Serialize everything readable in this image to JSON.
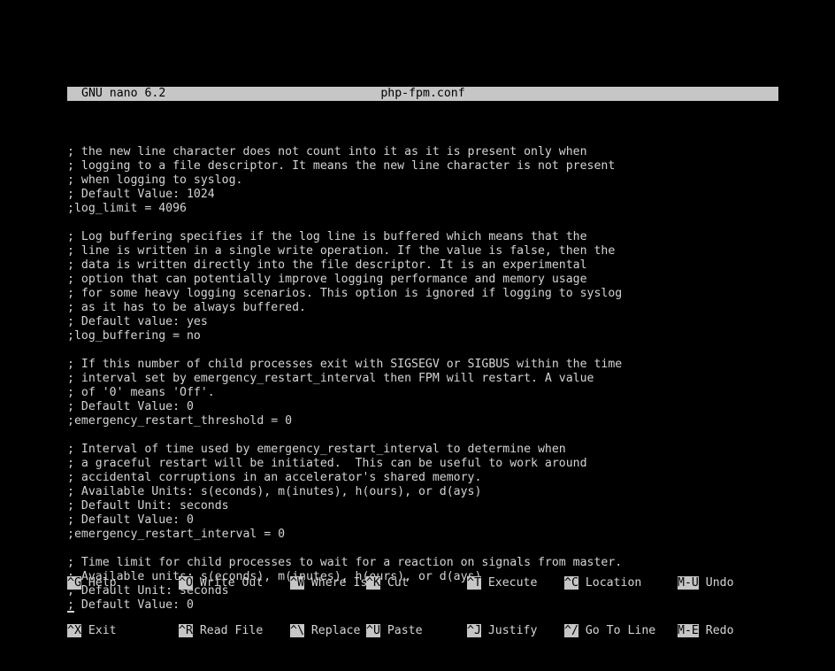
{
  "app": {
    "name": "GNU nano",
    "version_label": "GNU nano 6.2",
    "filename": "php-fpm.conf"
  },
  "editor": {
    "lines": [
      "; the new line character does not count into it as it is present only when",
      "; logging to a file descriptor. It means the new line character is not present",
      "; when logging to syslog.",
      "; Default Value: 1024",
      ";log_limit = 4096",
      "",
      "; Log buffering specifies if the log line is buffered which means that the",
      "; line is written in a single write operation. If the value is false, then the",
      "; data is written directly into the file descriptor. It is an experimental",
      "; option that can potentially improve logging performance and memory usage",
      "; for some heavy logging scenarios. This option is ignored if logging to syslog",
      "; as it has to be always buffered.",
      "; Default value: yes",
      ";log_buffering = no",
      "",
      "; If this number of child processes exit with SIGSEGV or SIGBUS within the time",
      "; interval set by emergency_restart_interval then FPM will restart. A value",
      "; of '0' means 'Off'.",
      "; Default Value: 0",
      ";emergency_restart_threshold = 0",
      "",
      "; Interval of time used by emergency_restart_interval to determine when",
      "; a graceful restart will be initiated.  This can be useful to work around",
      "; accidental corruptions in an accelerator's shared memory.",
      "; Available Units: s(econds), m(inutes), h(ours), or d(ays)",
      "; Default Unit: seconds",
      "; Default Value: 0",
      ";emergency_restart_interval = 0",
      "",
      "; Time limit for child processes to wait for a reaction on signals from master.",
      "; Available units: s(econds), m(inutes), h(ours), or d(ays)",
      "; Default Unit: seconds"
    ],
    "cursor_line": "; Default Value: 0",
    "cursor_char": ";",
    "cursor_rest": " Default Value: 0"
  },
  "helpbar": {
    "row1": [
      {
        "key": "^G",
        "label": "Help"
      },
      {
        "key": "^O",
        "label": "Write Out"
      },
      {
        "key": "^W",
        "label": "Where Is"
      },
      {
        "key": "^K",
        "label": "Cut"
      },
      {
        "key": "^T",
        "label": "Execute"
      },
      {
        "key": "^C",
        "label": "Location"
      },
      {
        "key": "M-U",
        "label": "Undo"
      }
    ],
    "row2": [
      {
        "key": "^X",
        "label": "Exit"
      },
      {
        "key": "^R",
        "label": "Read File"
      },
      {
        "key": "^\\",
        "label": "Replace"
      },
      {
        "key": "^U",
        "label": "Paste"
      },
      {
        "key": "^J",
        "label": "Justify"
      },
      {
        "key": "^/",
        "label": "Go To Line"
      },
      {
        "key": "M-E",
        "label": "Redo"
      }
    ]
  },
  "colors": {
    "background": "#000000",
    "foreground": "#d4d4d4",
    "inverse_bg": "#c6c6c6",
    "inverse_fg": "#000000"
  }
}
